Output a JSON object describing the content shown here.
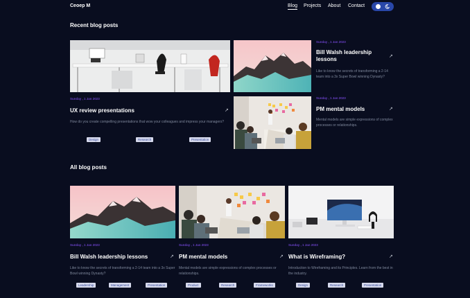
{
  "header": {
    "brand": "Ceoep M",
    "nav": [
      "Blog",
      "Projects",
      "About",
      "Contact"
    ],
    "toggle_icons": [
      "sun-icon",
      "moon-icon"
    ]
  },
  "recent": {
    "heading": "Recent blog posts",
    "posts": [
      {
        "date": "Sunday , 1 Jan 2023",
        "title": "UX review presentations",
        "desc": "How do you create compelling presentations that wow your colleagues and impress your managers?",
        "tags": [
          "Design",
          "Research",
          "Presentation"
        ]
      },
      {
        "date": "Sunday , 1 Jan 2023",
        "title": "Bill Walsh leadership lessons",
        "desc": "Like to know the secrets of transforming a 2-14 team into a 3x Super Bowl winning Dynasty?"
      },
      {
        "date": "Sunday , 1 Jan 2023",
        "title": "PM mental models",
        "desc": "Mental models are simple expressions of complex processes or relationships."
      }
    ]
  },
  "all": {
    "heading": "All blog posts",
    "posts": [
      {
        "date": "Sunday , 1 Jan 2023",
        "title": "Bill Walsh leadership lessons",
        "desc": "Like to know the secrets of transforming a 2-14 team into a 3x Super Bowl winning Dynasty?",
        "tags": [
          "Leadership",
          "Management",
          "Presentation"
        ]
      },
      {
        "date": "Sunday , 1 Jan 2023",
        "title": "PM mental models",
        "desc": "Mental models are simple expressions of complex processes or relationships.",
        "tags": [
          "Product",
          "Research",
          "Frameworks"
        ]
      },
      {
        "date": "Sunday , 1 Jan 2023",
        "title": "What is Wireframing?",
        "desc": "Introduction to Wireframing and its Principles. Learn from the best in the industry.",
        "tags": [
          "Design",
          "Research",
          "Presentation"
        ]
      }
    ]
  },
  "colors": {
    "background": "#090d1f",
    "accent": "#6941c6",
    "toggle": "#2947a9",
    "tag_bg": "#d6d9ec",
    "tag_text": "#364a9c"
  }
}
